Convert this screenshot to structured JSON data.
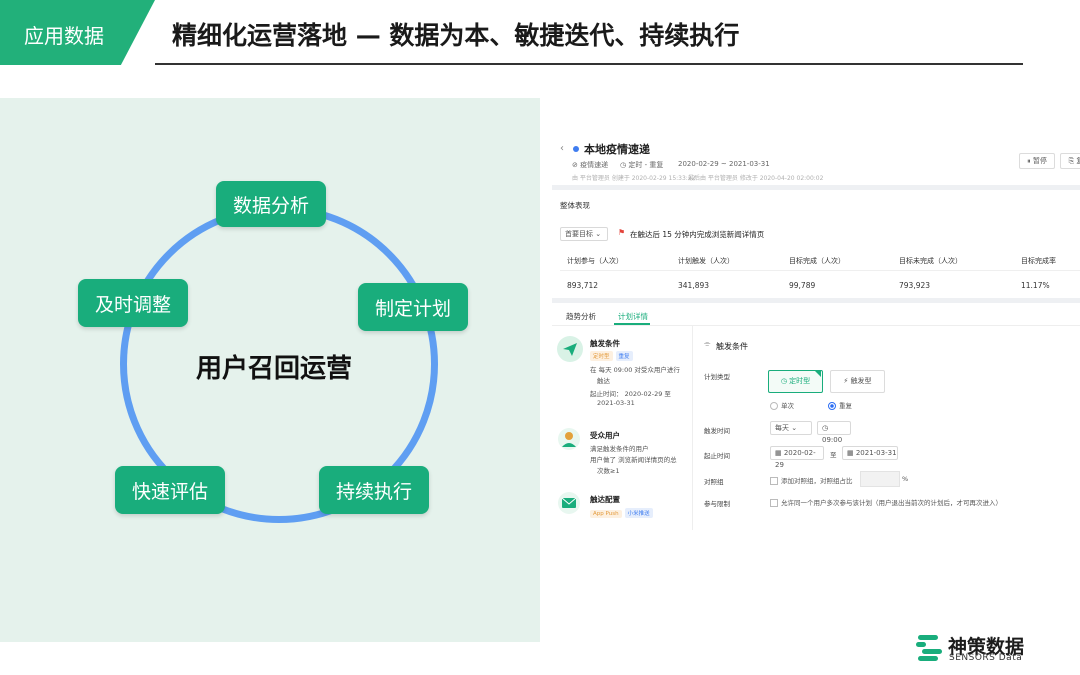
{
  "header": {
    "tag": "应用数据",
    "title": "精细化运营落地 — 数据为本、敏捷迭代、持续执行"
  },
  "diagram": {
    "center": "用户召回运营",
    "nodes": [
      "数据分析",
      "制定计划",
      "持续执行",
      "快速评估",
      "及时调整"
    ]
  },
  "app": {
    "back_icon": "chevron-left-icon",
    "plan_title": "本地疫情速递",
    "category": "疫情速递",
    "schedule": "定时 - 重复",
    "date_range": "2020-02-29 ~ 2021-03-31",
    "meta_created": "由 平台管理员 创建于 2020-02-29 15:33:22",
    "meta_updated": "最后由 平台管理员 修改于 2020-04-20 02:00:02",
    "btn_pause": "暂停",
    "btn_more": "复",
    "overview_title": "整体表现",
    "goal_select": "首要目标",
    "goal_text": "在触达后 15 分钟内完成浏览新闻详情页",
    "stats": {
      "headers": [
        "计划参与（人次）",
        "计划触发（人次）",
        "目标完成（人次）",
        "目标未完成（人次）",
        "目标完成率"
      ],
      "values": [
        "893,712",
        "341,893",
        "99,789",
        "793,923",
        "11.17%"
      ]
    },
    "tabs": [
      "趋势分析",
      "计划详情"
    ],
    "sidebar": {
      "trigger_title": "触发条件",
      "trigger_chips": [
        "定时型",
        "重复"
      ],
      "trigger_line1": "在 每天 09:00 对受众用户进行",
      "trigger_line1b": "触达",
      "trigger_line2": "起止时间： 2020-02-29 至",
      "trigger_line2b": "2021-03-31",
      "audience_title": "受众用户",
      "audience_line1": "满足触发条件的用户",
      "audience_line2": "用户做了 浏览新闻详情页的总",
      "audience_line2b": "次数≥1",
      "reach_title": "触达配置",
      "reach_chips": [
        "App Push",
        "小米推送"
      ]
    },
    "form": {
      "section_title": "触发条件",
      "plan_type_label": "计划类型",
      "type_timed": "定时型",
      "type_trigger": "触发型",
      "once": "单次",
      "repeat": "重复",
      "trigger_time_label": "触发时间",
      "freq": "每天",
      "time": "09:00",
      "range_label": "起止时间",
      "start": "2020-02-29",
      "to": "至",
      "end": "2021-03-31",
      "control_label": "对照组",
      "control_text": "添加对照组，对照组占比",
      "percent": "%",
      "participate_label": "参与限制",
      "participate_text": "允许同一个用户多次参与该计划（用户退出当前次的计划后，才可再次进入）"
    }
  },
  "brand": {
    "name_cn": "神策数据",
    "name_en": "SENSORS Data"
  },
  "colors": {
    "green": "#19ad7c",
    "ring": "#5f9ef2",
    "panel_bg": "#e5f2ec"
  }
}
